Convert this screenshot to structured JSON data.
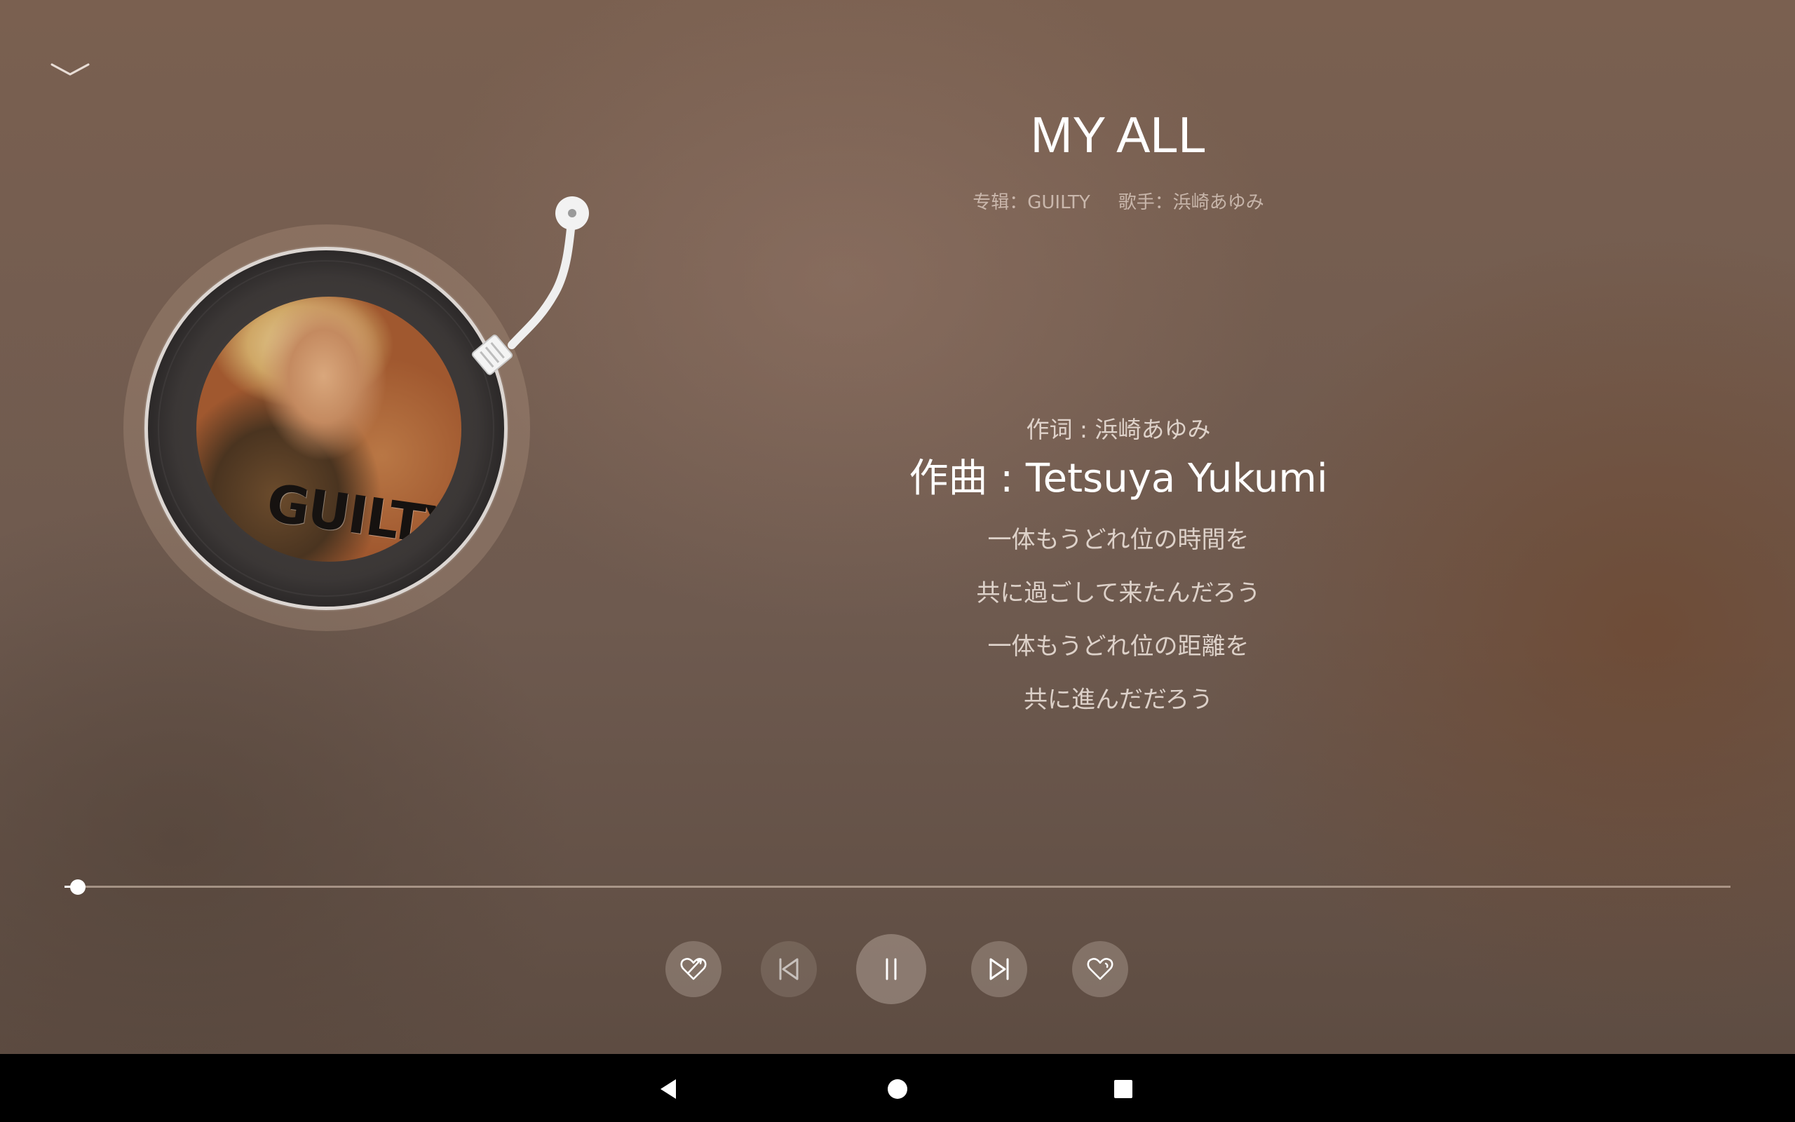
{
  "song": {
    "title": "MY ALL",
    "album_label": "专辑：GUILTY",
    "artist_label": "歌手：浜崎あゆみ"
  },
  "album_cover_text": "GUILTY",
  "lyrics": {
    "lyricist": "作词 : 浜崎あゆみ",
    "current": "作曲 : Tetsuya Yukumi",
    "lines": [
      "一体もうどれ位の時間を",
      "共に過ごして来たんだろう",
      "一体もうどれ位の距離を",
      "共に進んだだろう"
    ]
  },
  "progress": {
    "fraction": 0.008
  },
  "controls": {
    "dislike_icon": "heart-broken-icon",
    "prev_icon": "skip-previous-icon",
    "pause_icon": "pause-icon",
    "next_icon": "skip-next-icon",
    "like_icon": "heart-outline-icon"
  },
  "system_nav": {
    "back_icon": "back-triangle-icon",
    "home_icon": "home-circle-icon",
    "recents_icon": "recents-square-icon"
  },
  "colors": {
    "background": "#6e5a4f",
    "text_primary": "#ffffff",
    "navbar": "#000000"
  }
}
